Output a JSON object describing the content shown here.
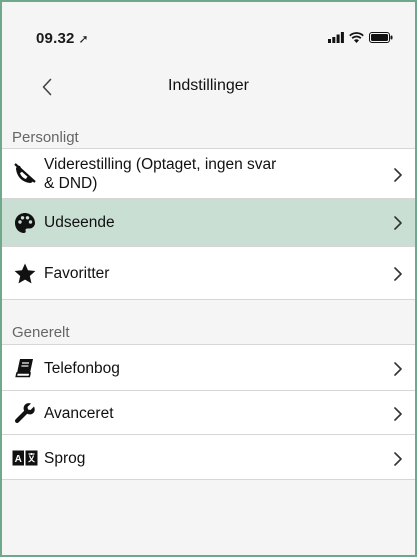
{
  "status_bar": {
    "time": "09.32",
    "location_arrow": "location-arrow-icon",
    "signal": "cell-signal-icon",
    "wifi": "wifi-icon",
    "battery": "battery-icon"
  },
  "nav": {
    "back_icon": "chevron-left-icon",
    "title": "Indstillinger"
  },
  "sections": {
    "personal": {
      "header": "Personligt",
      "items": [
        {
          "label_line1": "Viderestilling (Optaget, ingen svar",
          "label_line2": "& DND)",
          "icon": "call-forward-icon"
        },
        {
          "label": "Udseende",
          "icon": "palette-icon"
        },
        {
          "label": "Favoritter",
          "icon": "star-icon"
        }
      ]
    },
    "general": {
      "header": "Generelt",
      "items": [
        {
          "label": "Telefonbog",
          "icon": "book-icon"
        },
        {
          "label": "Avanceret",
          "icon": "wrench-icon"
        },
        {
          "label": "Sprog",
          "icon": "language-icon"
        }
      ]
    }
  },
  "colors": {
    "selected_row": "#c9dfd4",
    "frame_border": "#6fa88a"
  }
}
